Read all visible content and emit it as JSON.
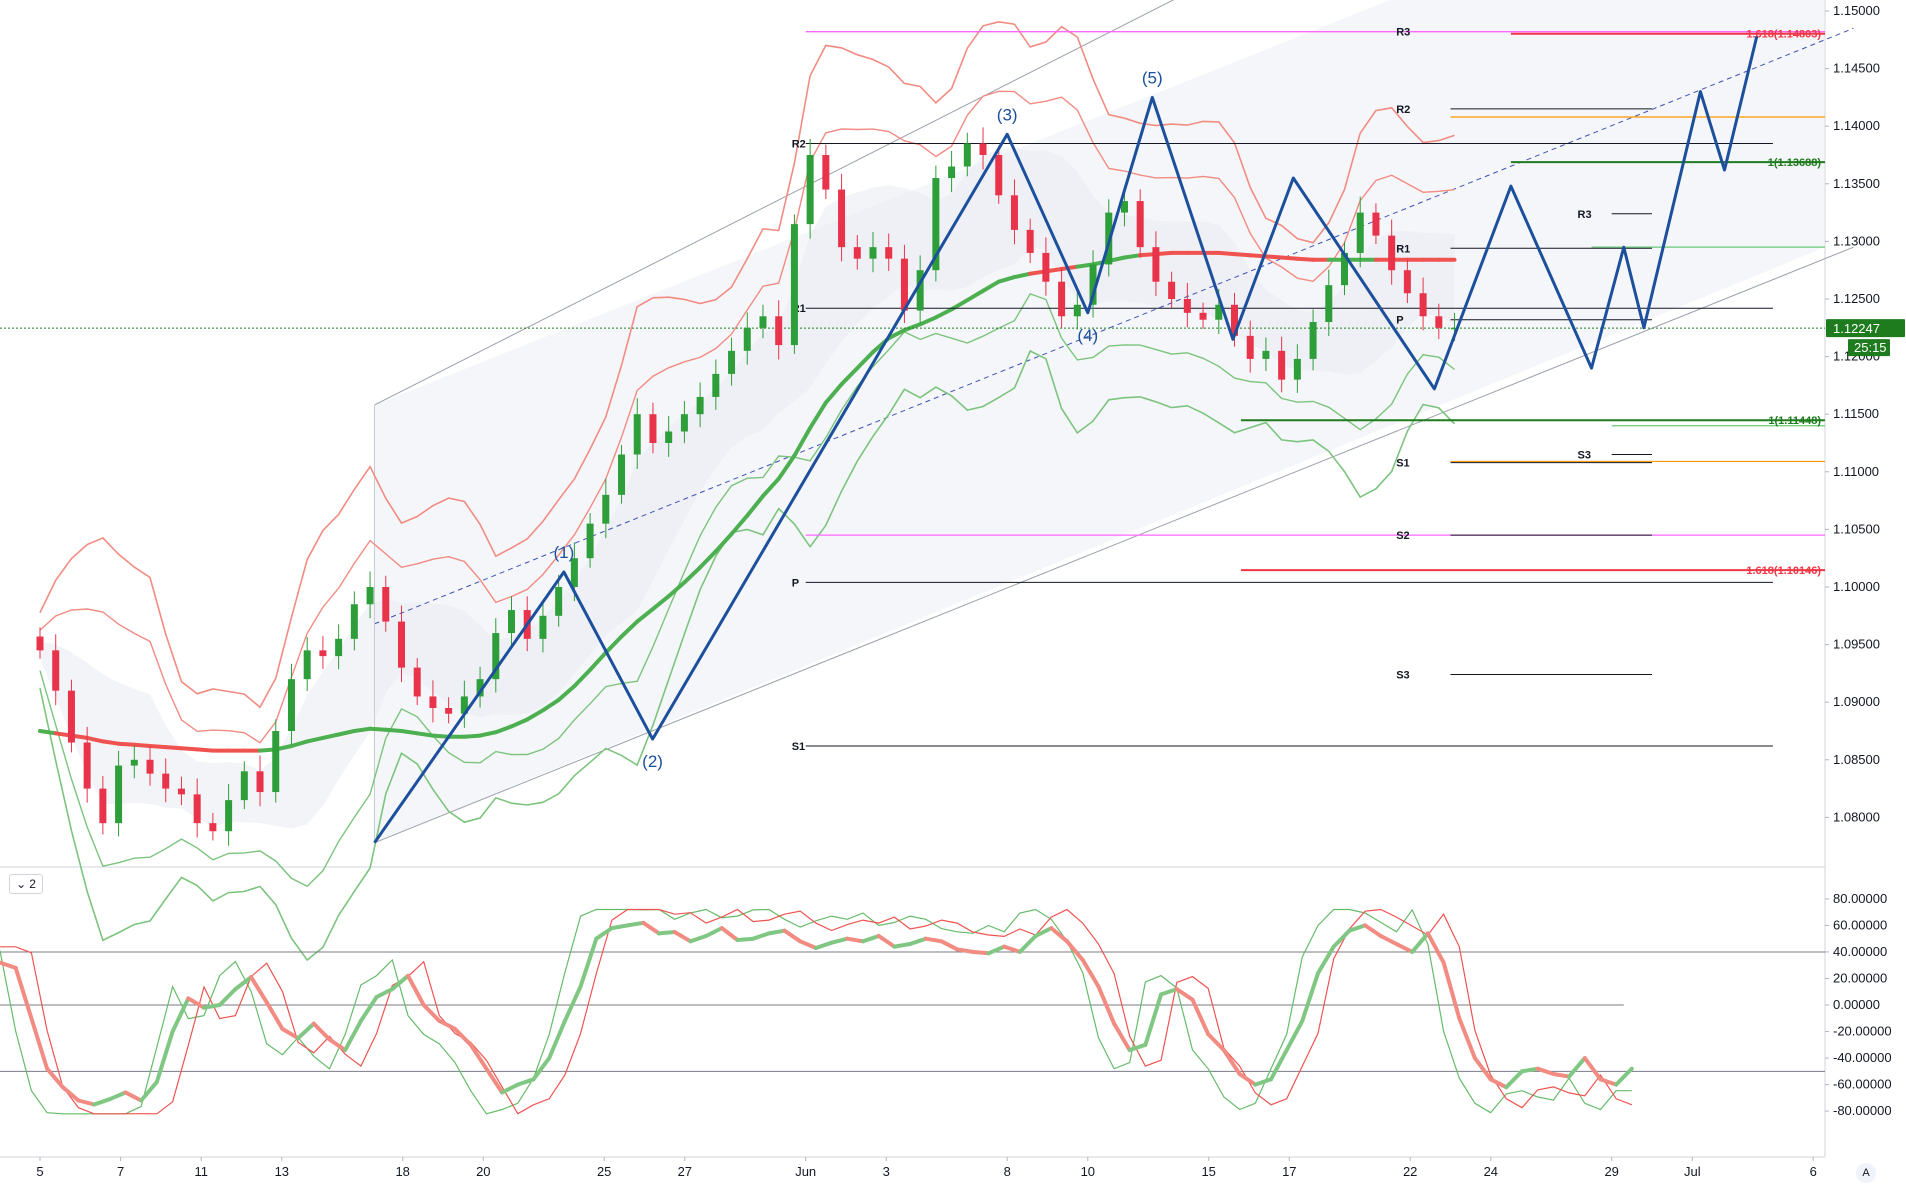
{
  "chart_data": {
    "type": "candlestick",
    "instrument_price_last": 1.12247,
    "countdown": "25:15",
    "y_axis": {
      "min": 1.076,
      "max": 1.1505,
      "ticks": [
        "1.15000",
        "1.14500",
        "1.14000",
        "1.13500",
        "1.13000",
        "1.12500",
        "1.12000",
        "1.11500",
        "1.11000",
        "1.10500",
        "1.10000",
        "1.09500",
        "1.09000",
        "1.08500",
        "1.08000"
      ]
    },
    "x_axis": {
      "ticks": [
        {
          "label": "5",
          "slot": 0
        },
        {
          "label": "7",
          "slot": 2
        },
        {
          "label": "11",
          "slot": 4
        },
        {
          "label": "13",
          "slot": 6
        },
        {
          "label": "18",
          "slot": 9
        },
        {
          "label": "20",
          "slot": 11
        },
        {
          "label": "25",
          "slot": 14
        },
        {
          "label": "27",
          "slot": 16
        },
        {
          "label": "Jun",
          "slot": 19
        },
        {
          "label": "3",
          "slot": 21
        },
        {
          "label": "8",
          "slot": 24
        },
        {
          "label": "10",
          "slot": 26
        },
        {
          "label": "15",
          "slot": 29
        },
        {
          "label": "17",
          "slot": 31
        },
        {
          "label": "22",
          "slot": 34
        },
        {
          "label": "24",
          "slot": 36
        },
        {
          "label": "29",
          "slot": 39
        },
        {
          "label": "Jul",
          "slot": 41
        },
        {
          "label": "6",
          "slot": 44
        }
      ]
    },
    "closes": [
      1.0945,
      1.091,
      1.0865,
      1.0825,
      1.0795,
      1.0845,
      1.085,
      1.0838,
      1.0825,
      1.082,
      1.0795,
      1.0788,
      1.0815,
      1.084,
      1.0822,
      1.0875,
      1.092,
      1.0945,
      1.094,
      1.0955,
      1.0985,
      1.1,
      1.097,
      1.093,
      1.0905,
      1.0895,
      1.089,
      1.0905,
      1.092,
      1.096,
      1.098,
      1.0955,
      1.0975,
      1.1,
      1.1025,
      1.1055,
      1.108,
      1.1115,
      1.115,
      1.1125,
      1.1135,
      1.115,
      1.1165,
      1.1185,
      1.1205,
      1.1225,
      1.1235,
      1.121,
      1.1315,
      1.1375,
      1.1345,
      1.1295,
      1.1285,
      1.1295,
      1.1285,
      1.124,
      1.1275,
      1.1355,
      1.1365,
      1.1385,
      1.1375,
      1.134,
      1.131,
      1.129,
      1.1265,
      1.1235,
      1.1245,
      1.128,
      1.1325,
      1.1335,
      1.1295,
      1.1265,
      1.125,
      1.1238,
      1.1232,
      1.1245,
      1.1218,
      1.1198,
      1.1205,
      1.118,
      1.1198,
      1.123,
      1.1262,
      1.129,
      1.1325,
      1.1305,
      1.1275,
      1.1255,
      1.1235,
      1.1225,
      1.1225
    ],
    "ema_slow": [
      1.0875,
      1.0873,
      1.0871,
      1.0869,
      1.0866,
      1.0864,
      1.0863,
      1.0862,
      1.0861,
      1.086,
      1.0859,
      1.0858,
      1.0858,
      1.0858,
      1.0858,
      1.0859,
      1.0862,
      1.0866,
      1.0869,
      1.0872,
      1.0875,
      1.0877,
      1.0876,
      1.0875,
      1.0873,
      1.0871,
      1.087,
      1.087,
      1.0871,
      1.0874,
      1.0879,
      1.0885,
      1.0893,
      1.0902,
      1.0914,
      1.0928,
      1.0943,
      1.0957,
      1.097,
      1.0981,
      1.0992,
      1.1004,
      1.1017,
      1.1031,
      1.1046,
      1.1062,
      1.1079,
      1.1094,
      1.1114,
      1.1138,
      1.116,
      1.1176,
      1.119,
      1.1204,
      1.1216,
      1.1223,
      1.1228,
      1.1234,
      1.1241,
      1.1249,
      1.1257,
      1.1265,
      1.1269,
      1.1272,
      1.1274,
      1.1276,
      1.1278,
      1.128,
      1.1283,
      1.1286,
      1.1288,
      1.1289,
      1.129,
      1.129,
      1.129,
      1.129,
      1.1289,
      1.1288,
      1.1287,
      1.1286,
      1.1285,
      1.1284,
      1.1284,
      1.1284,
      1.1284,
      1.1284,
      1.1284,
      1.1284,
      1.1284,
      1.1284,
      1.1284
    ],
    "levels": [
      {
        "label": "R3",
        "price": 1.1482,
        "color": "#ff66ff",
        "from_slot": 19.0,
        "to_slot": 44.5,
        "label_slot": 34.0
      },
      {
        "label": "R2",
        "price": 1.1385,
        "color": "#131722",
        "from_slot": 19.0,
        "to_slot": 43.0,
        "label_slot": 19.0
      },
      {
        "label": "R1",
        "price": 1.1242,
        "color": "#131722",
        "from_slot": 19.0,
        "to_slot": 43.0,
        "label_slot": 19.0
      },
      {
        "label": "P",
        "price": 1.1004,
        "color": "#131722",
        "from_slot": 19.0,
        "to_slot": 43.0,
        "label_slot": 19.0
      },
      {
        "label": "S1",
        "price": 1.0862,
        "color": "#131722",
        "from_slot": 19.0,
        "to_slot": 43.0,
        "label_slot": 19.0
      },
      {
        "label": "R2",
        "price": 1.1415,
        "color": "#131722",
        "from_slot": 35.0,
        "to_slot": 40.0,
        "label_slot": 34.0
      },
      {
        "label": "R1",
        "price": 1.1294,
        "color": "#131722",
        "from_slot": 35.0,
        "to_slot": 40.0,
        "label_slot": 34.0
      },
      {
        "label": "P",
        "price": 1.1232,
        "color": "#131722",
        "from_slot": 35.0,
        "to_slot": 40.0,
        "label_slot": 34.0
      },
      {
        "label": "S1",
        "price": 1.1108,
        "color": "#131722",
        "from_slot": 35.0,
        "to_slot": 40.0,
        "label_slot": 34.0
      },
      {
        "label": "S2",
        "price": 1.1045,
        "color": "#131722",
        "from_slot": 35.0,
        "to_slot": 40.0,
        "label_slot": 34.0
      },
      {
        "label": "S3",
        "price": 1.0924,
        "color": "#131722",
        "from_slot": 35.0,
        "to_slot": 40.0,
        "label_slot": 34.0
      },
      {
        "label": "R3",
        "price": 1.1324,
        "color": "#131722",
        "from_slot": 39.0,
        "to_slot": 40.0,
        "label_slot": 38.5
      },
      {
        "label": "S3",
        "price": 1.1115,
        "color": "#131722",
        "from_slot": 39.0,
        "to_slot": 40.0,
        "label_slot": 38.5
      }
    ],
    "extra_lines": [
      {
        "price": 1.1045,
        "color": "#ff66ff",
        "from_slot": 19.0,
        "to_slot": 45.0
      },
      {
        "price": 1.1408,
        "color": "#ff9800",
        "from_slot": 35.0,
        "to_slot": 45.0
      },
      {
        "price": 1.1109,
        "color": "#ff9800",
        "from_slot": 35.0,
        "to_slot": 45.0
      },
      {
        "price": 1.1295,
        "color": "#66cc77",
        "from_slot": 38.5,
        "to_slot": 45.0
      },
      {
        "price": 1.114,
        "color": "#66cc77",
        "from_slot": 39.0,
        "to_slot": 45.0
      }
    ],
    "fib_levels": [
      {
        "label": "1.618(1.14803)",
        "price": 1.14803,
        "color": "#f23645",
        "from_slot": 36.5,
        "to_slot": 45.0
      },
      {
        "label": "1(1.13688)",
        "price": 1.13688,
        "color": "#1e7b1e",
        "from_slot": 36.5,
        "to_slot": 45.0
      },
      {
        "label": "1(1.11448)",
        "price": 1.11448,
        "color": "#1e7b1e",
        "from_slot": 29.8,
        "to_slot": 45.0
      },
      {
        "label": "1.618(1.10146)",
        "price": 1.10146,
        "color": "#f23645",
        "from_slot": 29.8,
        "to_slot": 45.0
      }
    ],
    "elliott_waves": [
      {
        "label": "(1)",
        "slot": 13.0,
        "price": 1.1013,
        "above": true
      },
      {
        "label": "(2)",
        "slot": 15.2,
        "price": 1.0868,
        "above": false
      },
      {
        "label": "(3)",
        "slot": 24.0,
        "price": 1.1393,
        "above": true
      },
      {
        "label": "(4)",
        "slot": 26.0,
        "price": 1.1238,
        "above": false
      },
      {
        "label": "(5)",
        "slot": 27.6,
        "price": 1.1425,
        "above": true
      }
    ],
    "wave_path": [
      [
        8.3,
        1.0778
      ],
      [
        13.0,
        1.1013
      ],
      [
        15.2,
        1.0868
      ],
      [
        24.0,
        1.1393
      ],
      [
        26.0,
        1.1238
      ],
      [
        27.6,
        1.1425
      ],
      [
        29.6,
        1.1215
      ],
      [
        31.1,
        1.1355
      ],
      [
        34.6,
        1.1172
      ],
      [
        36.5,
        1.1348
      ],
      [
        38.5,
        1.119
      ],
      [
        39.3,
        1.1295
      ],
      [
        39.8,
        1.1225
      ],
      [
        41.2,
        1.143
      ],
      [
        41.8,
        1.1362
      ],
      [
        42.6,
        1.1478
      ]
    ],
    "channel": {
      "upper": [
        [
          8.3,
          1.1158
        ],
        [
          33.5,
          1.1605
        ]
      ],
      "lower": [
        [
          8.3,
          1.0778
        ],
        [
          45.0,
          1.1295
        ]
      ],
      "mid": [
        [
          8.3,
          1.0968
        ],
        [
          45.0,
          1.1485
        ]
      ]
    },
    "oscillator": {
      "y_ticks": [
        "80.00000",
        "60.00000",
        "40.00000",
        "20.00000",
        "0.00000",
        "-20.00000",
        "-40.00000",
        "-60.00000",
        "-80.00000"
      ],
      "min": -86,
      "max": 84,
      "levels": [
        40,
        0,
        -50
      ],
      "main": [
        32,
        28,
        -10,
        -48,
        -62,
        -72,
        -75,
        -71,
        -66,
        -72,
        -58,
        -20,
        5,
        -2,
        0,
        12,
        21,
        2,
        -18,
        -25,
        -14,
        -26,
        -34,
        -12,
        6,
        12,
        22,
        0,
        -12,
        -18,
        -30,
        -48,
        -66,
        -60,
        -56,
        -40,
        -12,
        14,
        50,
        58,
        60,
        62,
        54,
        55,
        48,
        52,
        58,
        49,
        50,
        54,
        56,
        48,
        43,
        47,
        50,
        48,
        52,
        44,
        46,
        50,
        48,
        42,
        40,
        39,
        44,
        40,
        52,
        58,
        48,
        34,
        14,
        -14,
        -34,
        -30,
        8,
        12,
        4,
        -22,
        -34,
        -52,
        -60,
        -56,
        -34,
        -12,
        24,
        44,
        56,
        60,
        52,
        46,
        40,
        54,
        32,
        -10,
        -40,
        -56,
        -62,
        -50,
        -48,
        -52,
        -54,
        -40,
        -56,
        -60,
        -48
      ]
    },
    "price_badge": {
      "text": "1.12247",
      "price": 1.12247
    },
    "countdown_badge": {
      "text": "25:15"
    }
  },
  "ui": {
    "pane_toggle": "2",
    "auto_scale": "A"
  }
}
